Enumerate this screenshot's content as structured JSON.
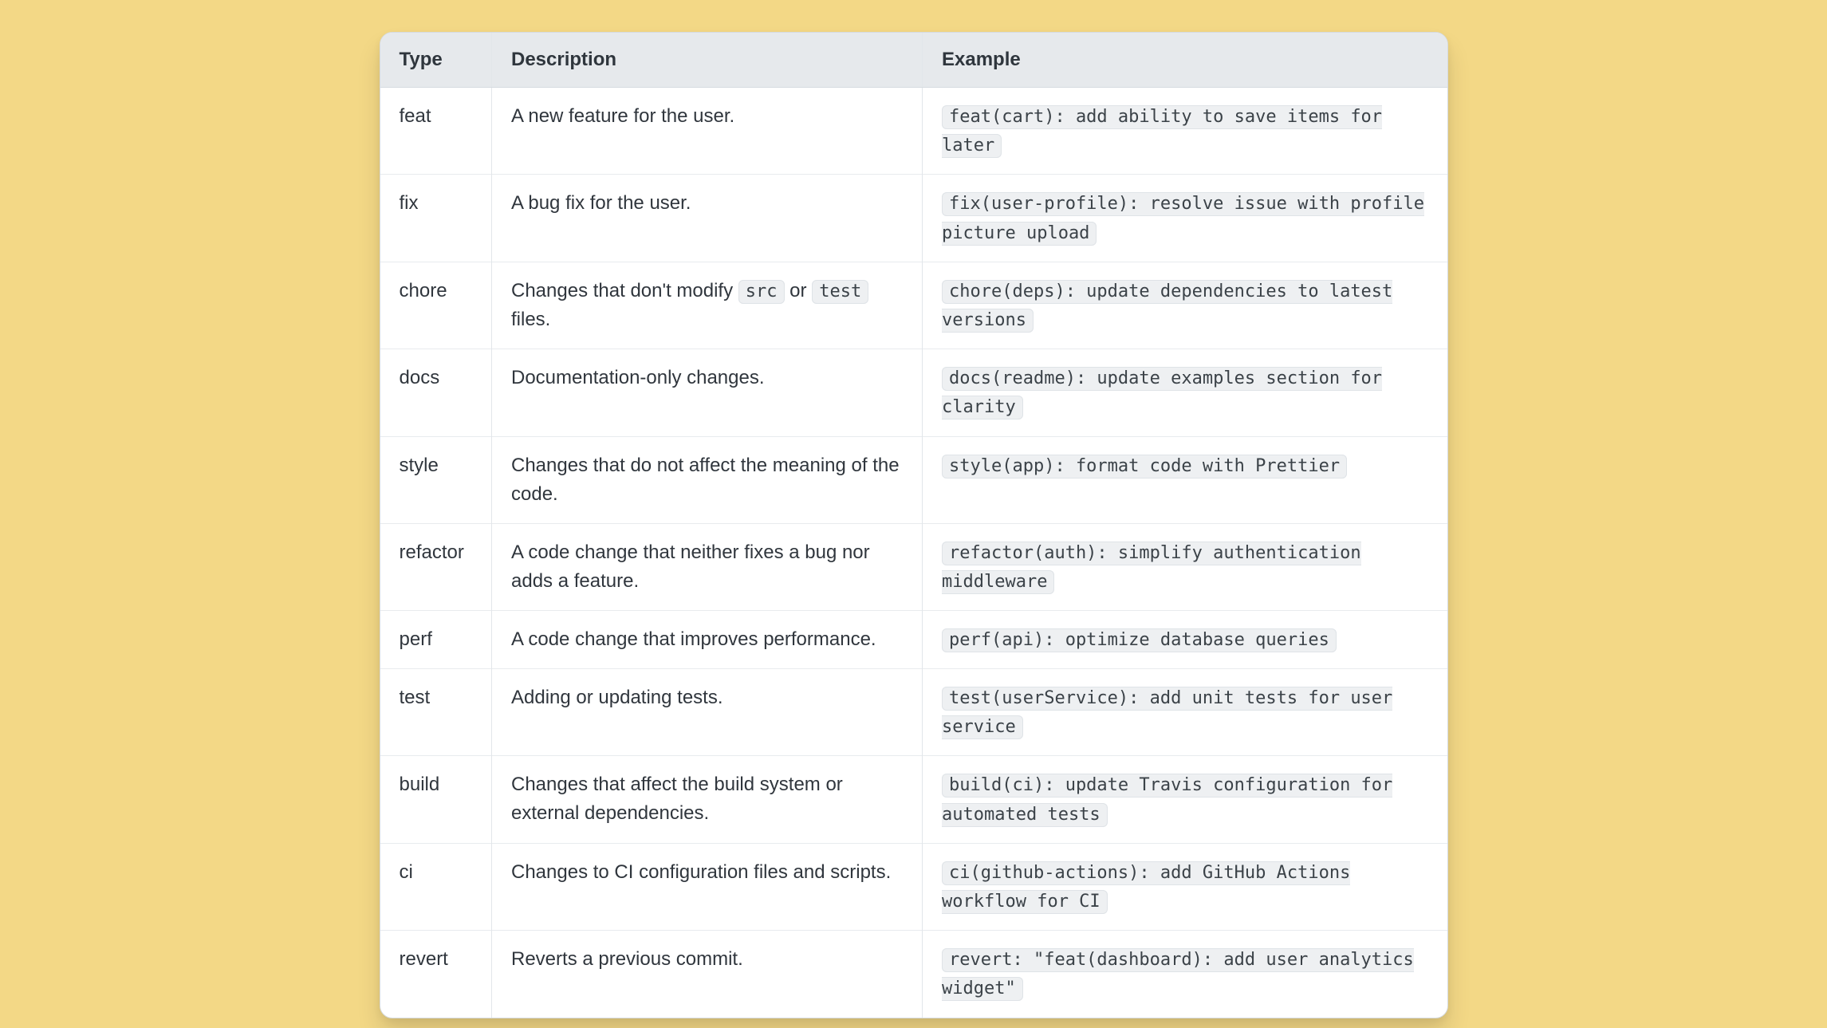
{
  "headers": {
    "type": "Type",
    "description": "Description",
    "example": "Example"
  },
  "rows": [
    {
      "type": "feat",
      "description_parts": [
        {
          "kind": "text",
          "value": "A new feature for the user."
        }
      ],
      "example": "feat(cart): add ability to save items for later"
    },
    {
      "type": "fix",
      "description_parts": [
        {
          "kind": "text",
          "value": "A bug fix for the user."
        }
      ],
      "example": "fix(user-profile): resolve issue with profile picture upload"
    },
    {
      "type": "chore",
      "description_parts": [
        {
          "kind": "text",
          "value": "Changes that don't modify "
        },
        {
          "kind": "code",
          "value": "src"
        },
        {
          "kind": "text",
          "value": " or "
        },
        {
          "kind": "code",
          "value": "test"
        },
        {
          "kind": "text",
          "value": " files."
        }
      ],
      "example": "chore(deps): update dependencies to latest versions"
    },
    {
      "type": "docs",
      "description_parts": [
        {
          "kind": "text",
          "value": "Documentation-only changes."
        }
      ],
      "example": "docs(readme): update examples section for clarity"
    },
    {
      "type": "style",
      "description_parts": [
        {
          "kind": "text",
          "value": "Changes that do not affect the meaning of the code."
        }
      ],
      "example": "style(app): format code with Prettier"
    },
    {
      "type": "refactor",
      "description_parts": [
        {
          "kind": "text",
          "value": "A code change that neither fixes a bug nor adds a feature."
        }
      ],
      "example": "refactor(auth): simplify authentication middleware"
    },
    {
      "type": "perf",
      "description_parts": [
        {
          "kind": "text",
          "value": "A code change that improves performance."
        }
      ],
      "example": "perf(api): optimize database queries"
    },
    {
      "type": "test",
      "description_parts": [
        {
          "kind": "text",
          "value": "Adding or updating tests."
        }
      ],
      "example": "test(userService): add unit tests for user service"
    },
    {
      "type": "build",
      "description_parts": [
        {
          "kind": "text",
          "value": "Changes that affect the build system or external dependencies."
        }
      ],
      "example": "build(ci): update Travis configuration for automated tests"
    },
    {
      "type": "ci",
      "description_parts": [
        {
          "kind": "text",
          "value": "Changes to CI configuration files and scripts."
        }
      ],
      "example": "ci(github-actions): add GitHub Actions workflow for CI"
    },
    {
      "type": "revert",
      "description_parts": [
        {
          "kind": "text",
          "value": "Reverts a previous commit."
        }
      ],
      "example": "revert: \"feat(dashboard): add user analytics widget\""
    }
  ]
}
